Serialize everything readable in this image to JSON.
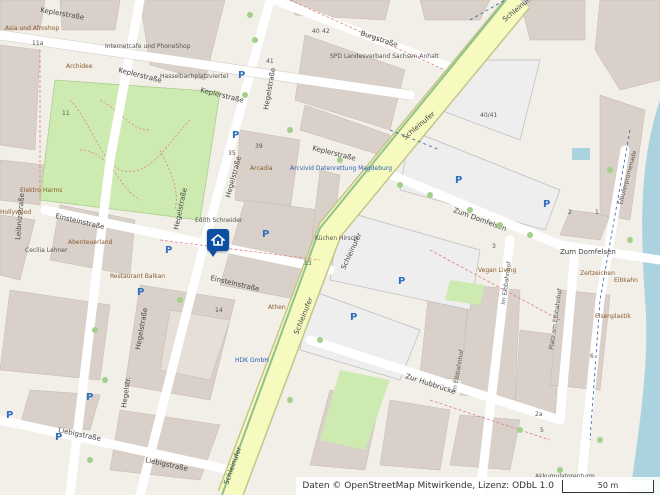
{
  "streets": {
    "keplerstrasse_1": "Keplerstraße",
    "keplerstrasse_2": "Keplerstraße",
    "keplerstrasse_3": "Keplerstraße",
    "keplerstrasse_4": "Keplerstraße",
    "burgstrasse": "Burgstraße",
    "schleinufer_1": "Schleinufer",
    "schleinufer_2": "Schleinufer",
    "schleinufer_3": "Schleinufer",
    "schleinufer_4": "Schleinufer",
    "schleinufer_5": "Schleinufer",
    "hegelstrasse_1": "Hegelstraße",
    "hegelstrasse_2": "Hegelstraße",
    "hegelstrasse_3": "Hegelstraße",
    "hegelstrasse_4": "Hegelstraße",
    "hegelstrasse_5": "Hegelstraße",
    "hegelstrasse_6": "Hegelstr.",
    "einsteinstrasse_1": "Einsteinstraße",
    "einsteinstrasse_2": "Einsteinstraße",
    "leibnizstrasse": "Leibnizstraße",
    "liebigstrasse_1": "Liebigstraße",
    "liebigstrasse_2": "Liebigstraße",
    "zum_domfelsen_1": "Zum Domfelsen",
    "zum_domfelsen_2": "Zum Domfelsen",
    "zur_hubbruecke": "Zur Hubbrücke",
    "elbuferpromenade": "Elbuferpromenade",
    "im_elbbahnhof_1": "Im Elbbahnhof",
    "im_elbbahnhof_2": "Im Elbbahnhof",
    "platz_am_elbbahnhof": "Platz am Elbbahnhof"
  },
  "pois": {
    "asia_und_afroshop": "Asia und Afroshop",
    "internetcafe": "Internetcafe und PhoneShop",
    "archidee": "Archidee",
    "hasselbachplatzviertel": "Hasselbachplatzviertel",
    "spd": "SPD Landesverband Sachsen-Anhalt",
    "arcadia": "Arcadia",
    "ars_vivid": "Arcvivid Datenrettung Magdeburg",
    "edith_schneider": "Edith Schneider",
    "elektro_harms": "Elektro Harms",
    "hollywood": "Hollywood",
    "cecilia_lehner": "Cecilia Lehner",
    "abenteuerland": "Abenteuerland",
    "restaurant_balkan": "Restaurant Balkan",
    "kuechen_hirsch": "Küchen Hirsch",
    "athen": "Athen",
    "hdk_gmbh": "HDK GmbH",
    "vegan_living": "Vegan Living",
    "zeitzeichen": "Zeitzeichen",
    "elbkahn": "Elbkahn",
    "eisenplastik": "Eisenplastik",
    "akkumulatorenturm": "Akkumulatorenturm"
  },
  "numbers": {
    "n40": "40",
    "n42": "42",
    "n41": "41",
    "n40_41": "40/41",
    "n39": "39",
    "n35": "35",
    "n14": "14",
    "n13": "13",
    "n11": "11",
    "n6": "6",
    "n5": "5",
    "n3": "3",
    "n2": "2",
    "n1": "1",
    "n2a": "2a",
    "n40b": "40",
    "n11a": "11a",
    "n39b": "39"
  },
  "parking_symbol": "P",
  "attribution": {
    "text": "Daten © OpenStreetMap Mitwirkende, Lizenz: ODbL 1.0",
    "scale": "50 m"
  },
  "colors": {
    "background": "#f2efe9",
    "building": "#d9d0c9",
    "park": "#cdebb0",
    "main_road": "#f7fabf",
    "main_road_casing": "#c4c58a",
    "water": "#aad3df",
    "parking_area": "#eeeeee",
    "marker": "#0b4fa3"
  },
  "icons": {
    "home_marker": "home-icon"
  }
}
